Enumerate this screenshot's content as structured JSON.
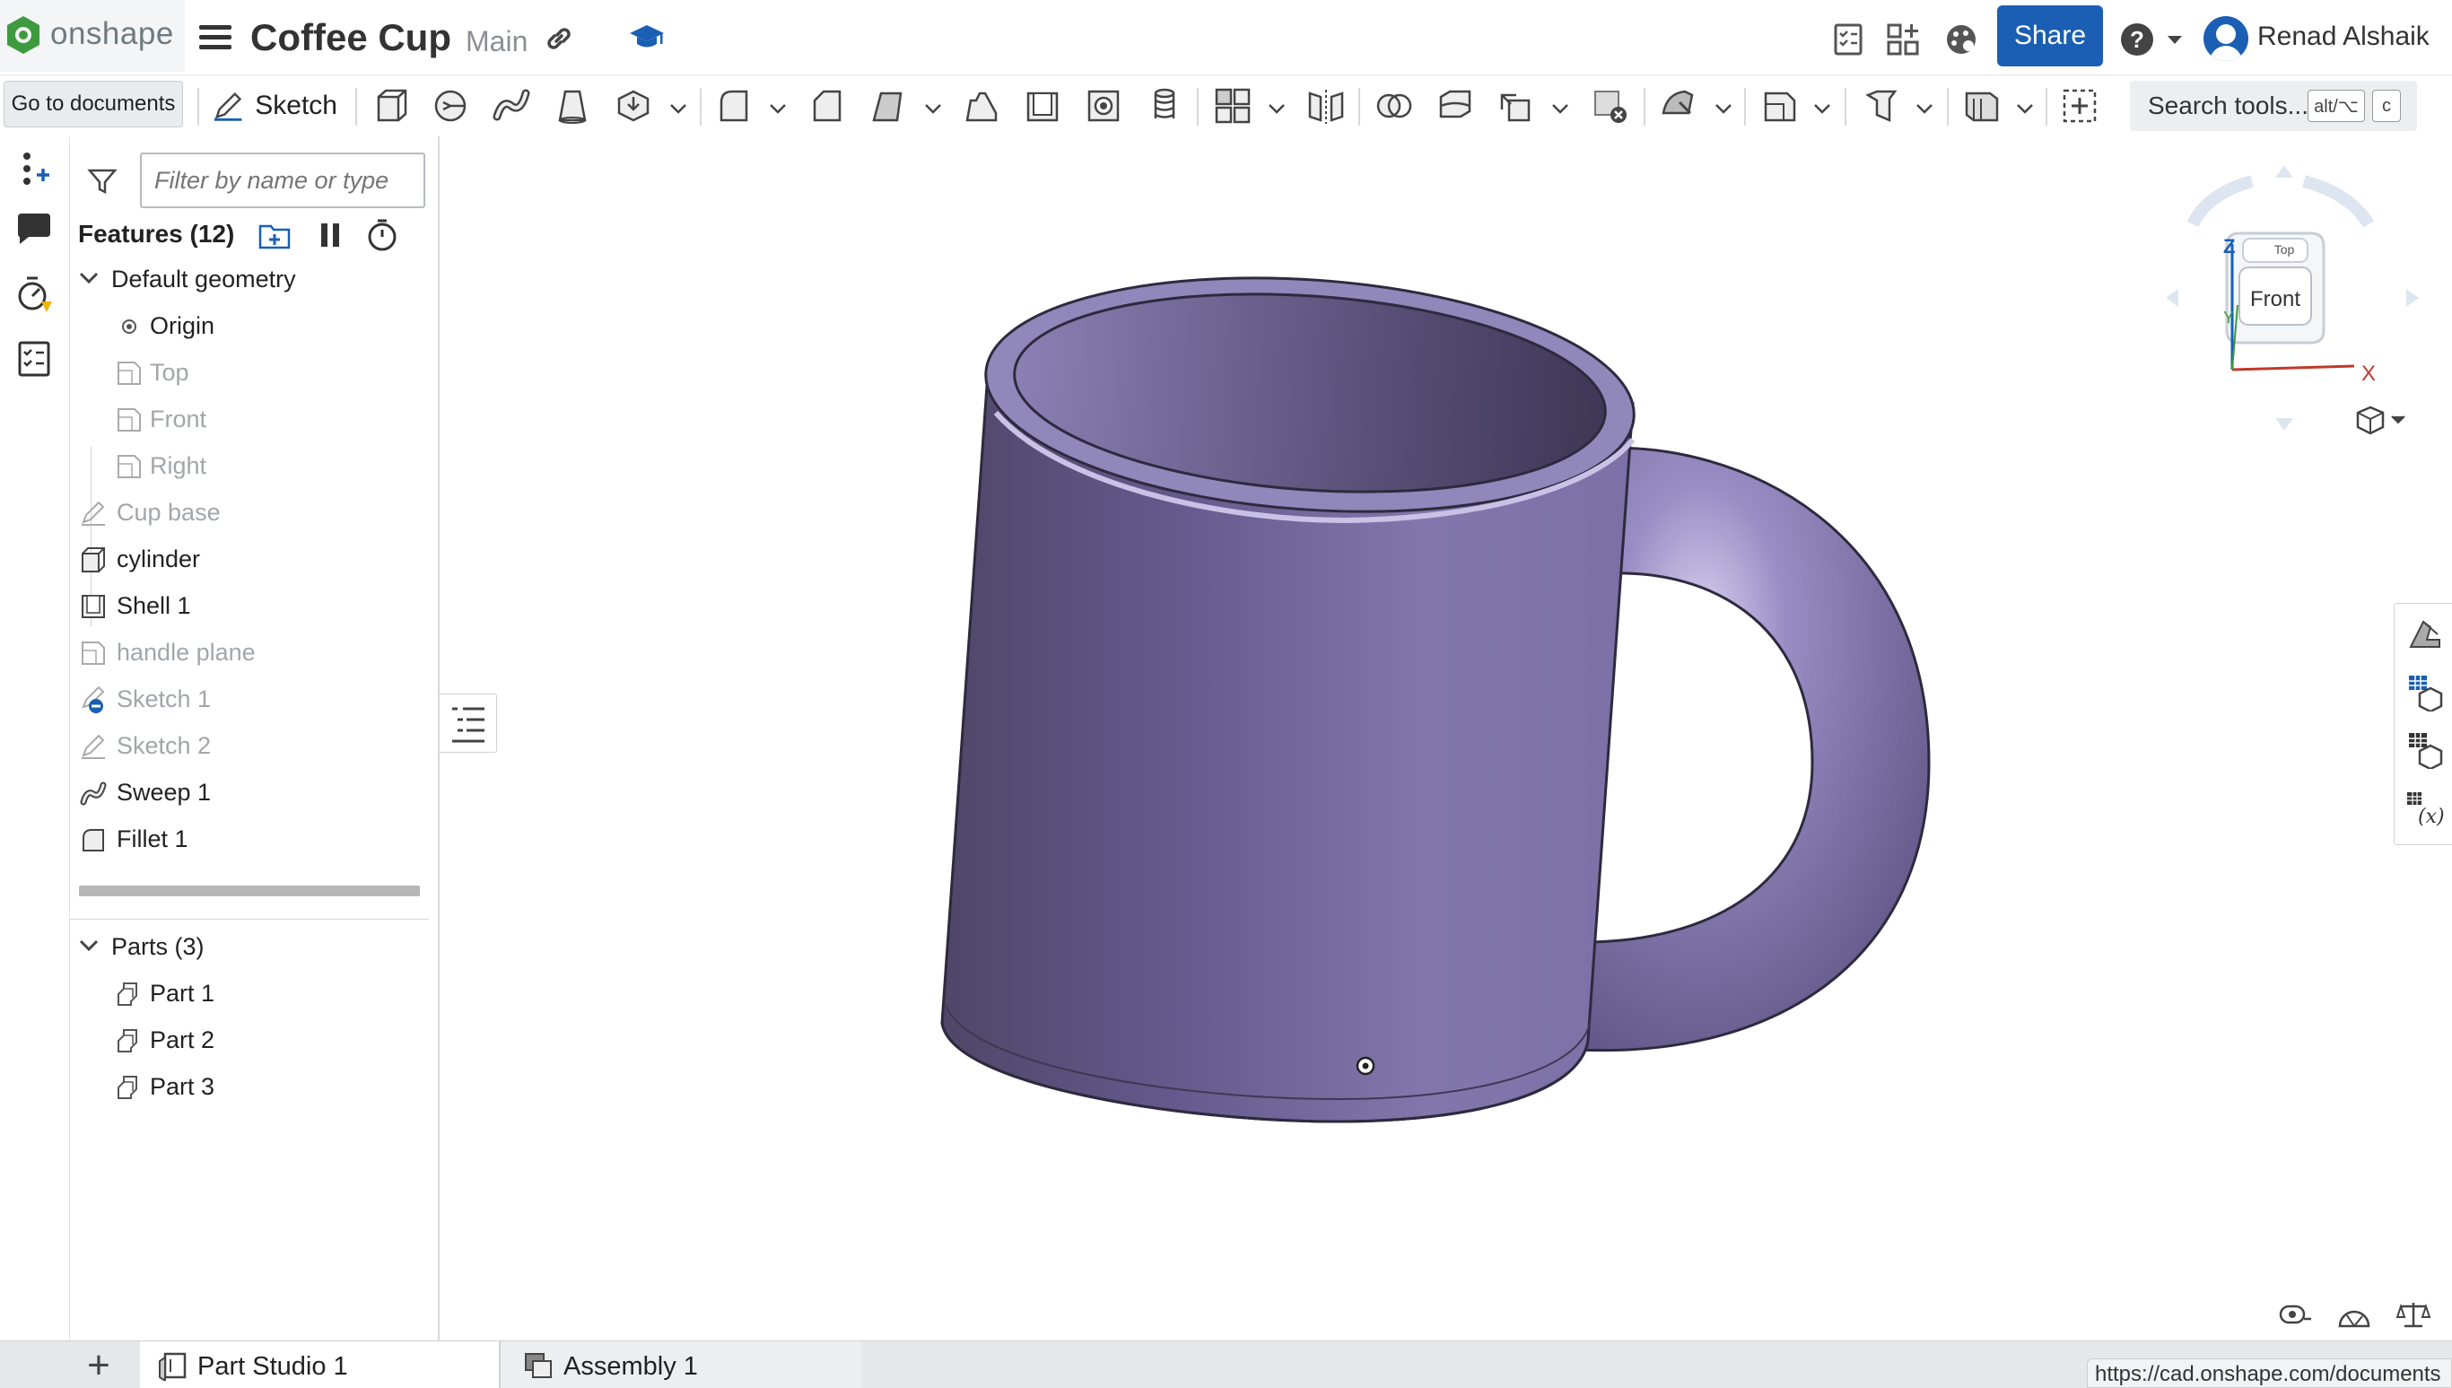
{
  "app": {
    "logo_text": "onshape",
    "document_title": "Coffee Cup",
    "branch": "Main",
    "share_label": "Share",
    "help_label": "?",
    "user_name": "Renad Alshaik"
  },
  "toolbar": {
    "goto_documents": "Go to documents",
    "sketch_label": "Sketch",
    "search_tools_label": "Search tools...",
    "search_shortcut_1": "alt/⌥",
    "search_shortcut_2": "c"
  },
  "feature_panel": {
    "filter_placeholder": "Filter by name or type",
    "features_heading": "Features (12)",
    "default_geometry": "Default geometry",
    "origin": "Origin",
    "planes": [
      "Top",
      "Front",
      "Right"
    ],
    "features": [
      {
        "label": "Cup base",
        "icon": "sketch-icon",
        "state": "dim"
      },
      {
        "label": "cylinder",
        "icon": "extrude-icon",
        "state": "normal"
      },
      {
        "label": "Shell 1",
        "icon": "shell-icon",
        "state": "normal"
      },
      {
        "label": "handle plane",
        "icon": "plane-icon",
        "state": "dim"
      },
      {
        "label": "Sketch 1",
        "icon": "sketch-error-icon",
        "state": "dim"
      },
      {
        "label": "Sketch 2",
        "icon": "sketch-icon",
        "state": "dim"
      },
      {
        "label": "Sweep 1",
        "icon": "sweep-icon",
        "state": "normal"
      },
      {
        "label": "Fillet 1",
        "icon": "fillet-icon",
        "state": "normal"
      }
    ],
    "parts_heading": "Parts (3)",
    "parts": [
      "Part 1",
      "Part 2",
      "Part 3"
    ]
  },
  "viewcube": {
    "face_front": "Front",
    "face_top": "Top",
    "axis_x": "X",
    "axis_y": "Y",
    "axis_z": "Z"
  },
  "tabs": {
    "add_label": "+",
    "items": [
      {
        "label": "Part Studio 1",
        "active": true
      },
      {
        "label": "Assembly 1",
        "active": false
      }
    ]
  },
  "status": {
    "url_tooltip": "https://cad.onshape.com/documents"
  },
  "colors": {
    "accent": "#1a5fb4",
    "mug": "#7c6ea3"
  }
}
